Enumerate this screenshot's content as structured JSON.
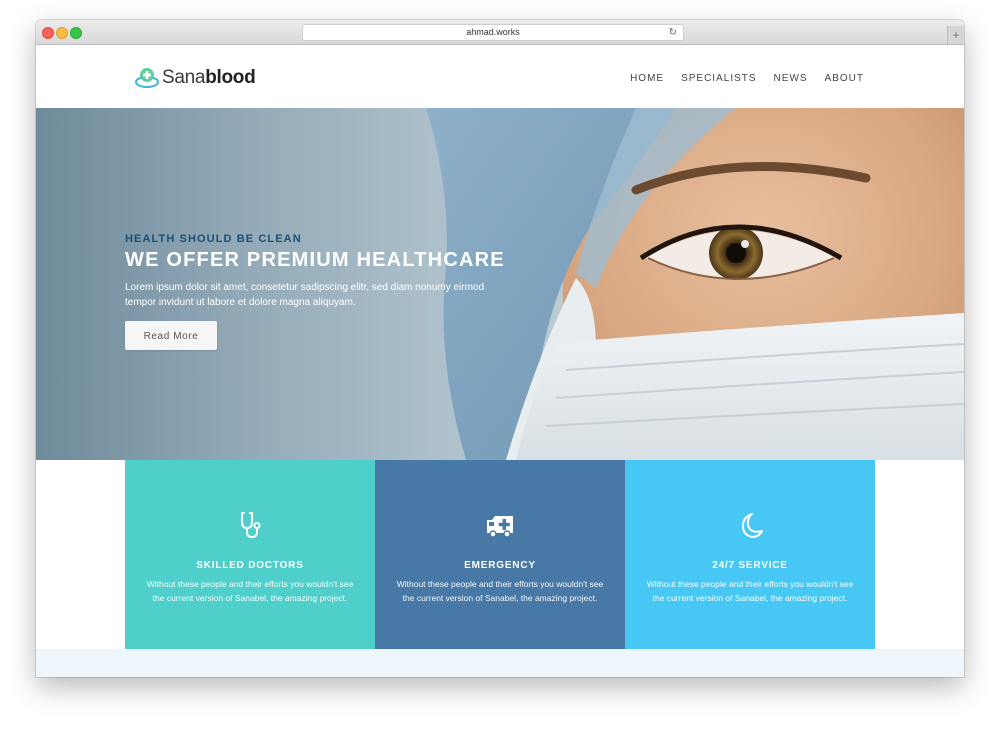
{
  "browser": {
    "url": "ahmad.works",
    "reload_glyph": "↻",
    "newtab_glyph": "+"
  },
  "header": {
    "logo_part1": "Sana",
    "logo_part2": "blood",
    "nav": [
      {
        "label": "HOME"
      },
      {
        "label": "SPECIALISTS"
      },
      {
        "label": "NEWS"
      },
      {
        "label": "ABOUT"
      }
    ]
  },
  "hero": {
    "kicker": "HEALTH SHOULD BE CLEAN",
    "title": "WE OFFER PREMIUM HEALTHCARE",
    "text": "Lorem ipsum dolor sit amet, consetetur sadipscing elitr, sed diam nonumy eirmod tempor invidunt ut labore et dolore magna aliquyam.",
    "button": "Read More",
    "image_subject": "face-of-surgeon-with-cap-and-mask"
  },
  "features": [
    {
      "icon": "stethoscope-icon",
      "title": "SKILLED DOCTORS",
      "text": "Without these people and their efforts you wouldn't see the current version of Sanabel, the amazing project.",
      "color": "#4ecfca"
    },
    {
      "icon": "ambulance-icon",
      "title": "EMERGENCY",
      "text": "Without these people and their efforts you wouldn't see the current version of Sanabel, the amazing project.",
      "color": "#4778a6"
    },
    {
      "icon": "moon-icon",
      "title": "24/7 SERVICE",
      "text": "Without these people and their efforts you wouldn't see the current version of Sanabel, the amazing project.",
      "color": "#47c8f4"
    }
  ],
  "colors": {
    "accent_dark": "#1d4f72",
    "strip": "#eef6fc"
  }
}
